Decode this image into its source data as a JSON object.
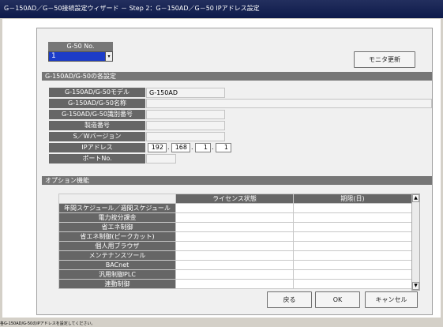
{
  "window": {
    "title": "G－150AD／G－50接続設定ウィザード － Step 2：G－150AD／G－50 IPアドレス設定"
  },
  "device_select": {
    "label": "G-50 No.",
    "value": "1",
    "arrow": "▾"
  },
  "buttons": {
    "refresh": "モニタ更新",
    "back": "戻る",
    "ok": "OK",
    "cancel": "キャンセル"
  },
  "settings": {
    "header": "G-150AD/G-50の各設定",
    "model_label": "G-150AD/G-50モデル",
    "model_value": "G-150AD",
    "name_label": "G-150AD/G-50名称",
    "name_value": "",
    "id_label": "G-150AD/G-50識別番号",
    "id_value": "",
    "serial_label": "製造番号",
    "serial_value": "",
    "sw_label": "S／Wバージョン",
    "sw_value": "",
    "ip_label": "IPアドレス",
    "ip": [
      "192",
      "168",
      "1",
      "1"
    ],
    "ip_sep": ".",
    "port_label": "ポートNo.",
    "port_value": ""
  },
  "options": {
    "header": "オプション機能",
    "columns": [
      "ライセンス状態",
      "期限(日)"
    ],
    "rows": [
      "年間スケジュール／週間スケジュール",
      "電力按分課金",
      "省エネ制御",
      "省エネ制御(ピークカット)",
      "個人用ブラウザ",
      "メンテナンスツール",
      "BACnet",
      "汎用制御PLC",
      "連動制御"
    ],
    "scroll_up": "▲",
    "scroll_down": "▼"
  },
  "status_bar": {
    "text": "各G-150AD/G-50のIPアドレスを設定してください。"
  }
}
